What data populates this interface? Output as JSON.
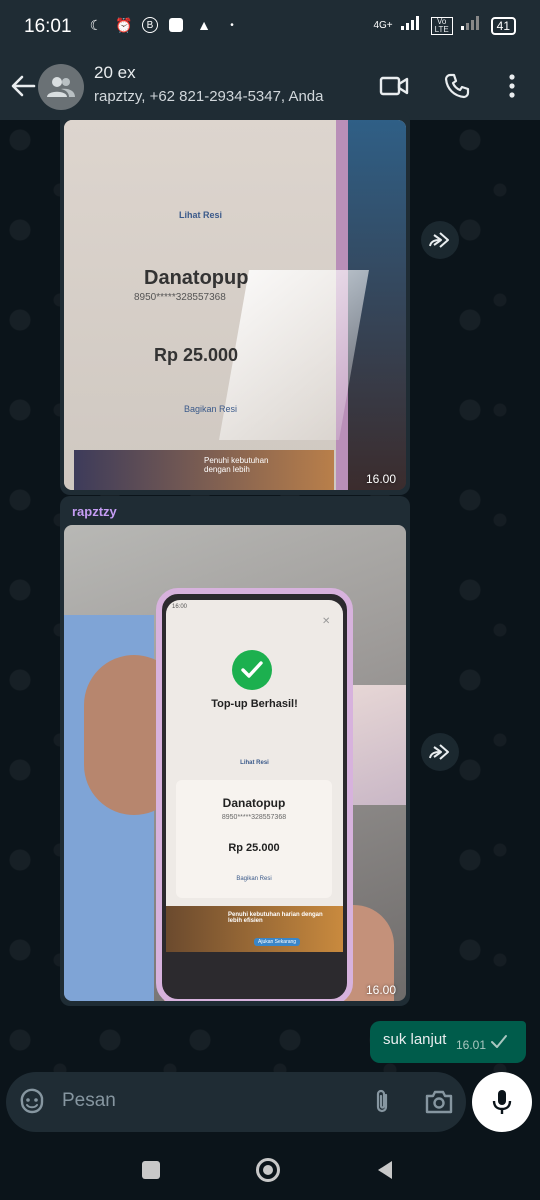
{
  "status_bar": {
    "time": "16:01",
    "network": "4G+",
    "lte": "Vo LTE",
    "battery": "41"
  },
  "header": {
    "title": "20 ex",
    "subtitle": "rapztzy, +62 821-2934-5347, Anda"
  },
  "messages": [
    {
      "type": "image",
      "time": "16.00",
      "receipt": {
        "logo": "Lihat Resi",
        "merchant": "Danatopup",
        "account": "8950*****328557368",
        "amount": "Rp 25.000",
        "share": "Bagikan Resi",
        "banner": "Penuhi kebutuhan dengan lebih"
      }
    },
    {
      "type": "image",
      "sender": "rapztzy",
      "time": "16.00",
      "receipt": {
        "phone_time": "16:00",
        "headline": "Top-up Berhasil!",
        "logo": "Lihat Resi",
        "merchant": "Danatopup",
        "account": "8950*****328557368",
        "amount": "Rp 25.000",
        "share": "Bagikan Resi",
        "banner": "Penuhi kebutuhan harian dengan lebih efisien",
        "banner_button": "Ajukan Sekarang"
      }
    },
    {
      "type": "text",
      "outgoing": true,
      "text": "suk lanjut",
      "time": "16.01"
    }
  ],
  "input": {
    "placeholder": "Pesan"
  },
  "colors": {
    "header_bg": "#1f2c34",
    "chat_bg": "#0b141a",
    "outgoing_bubble": "#005c4b",
    "sender_name": "#c59df4",
    "success": "#1cb04f"
  },
  "icons": [
    "back-arrow-icon",
    "group-avatar-icon",
    "video-call-icon",
    "phone-call-icon",
    "more-vert-icon",
    "forward-icon",
    "emoji-sticker-icon",
    "attach-icon",
    "camera-icon",
    "mic-icon",
    "nav-recents-icon",
    "nav-home-icon",
    "nav-back-icon"
  ]
}
